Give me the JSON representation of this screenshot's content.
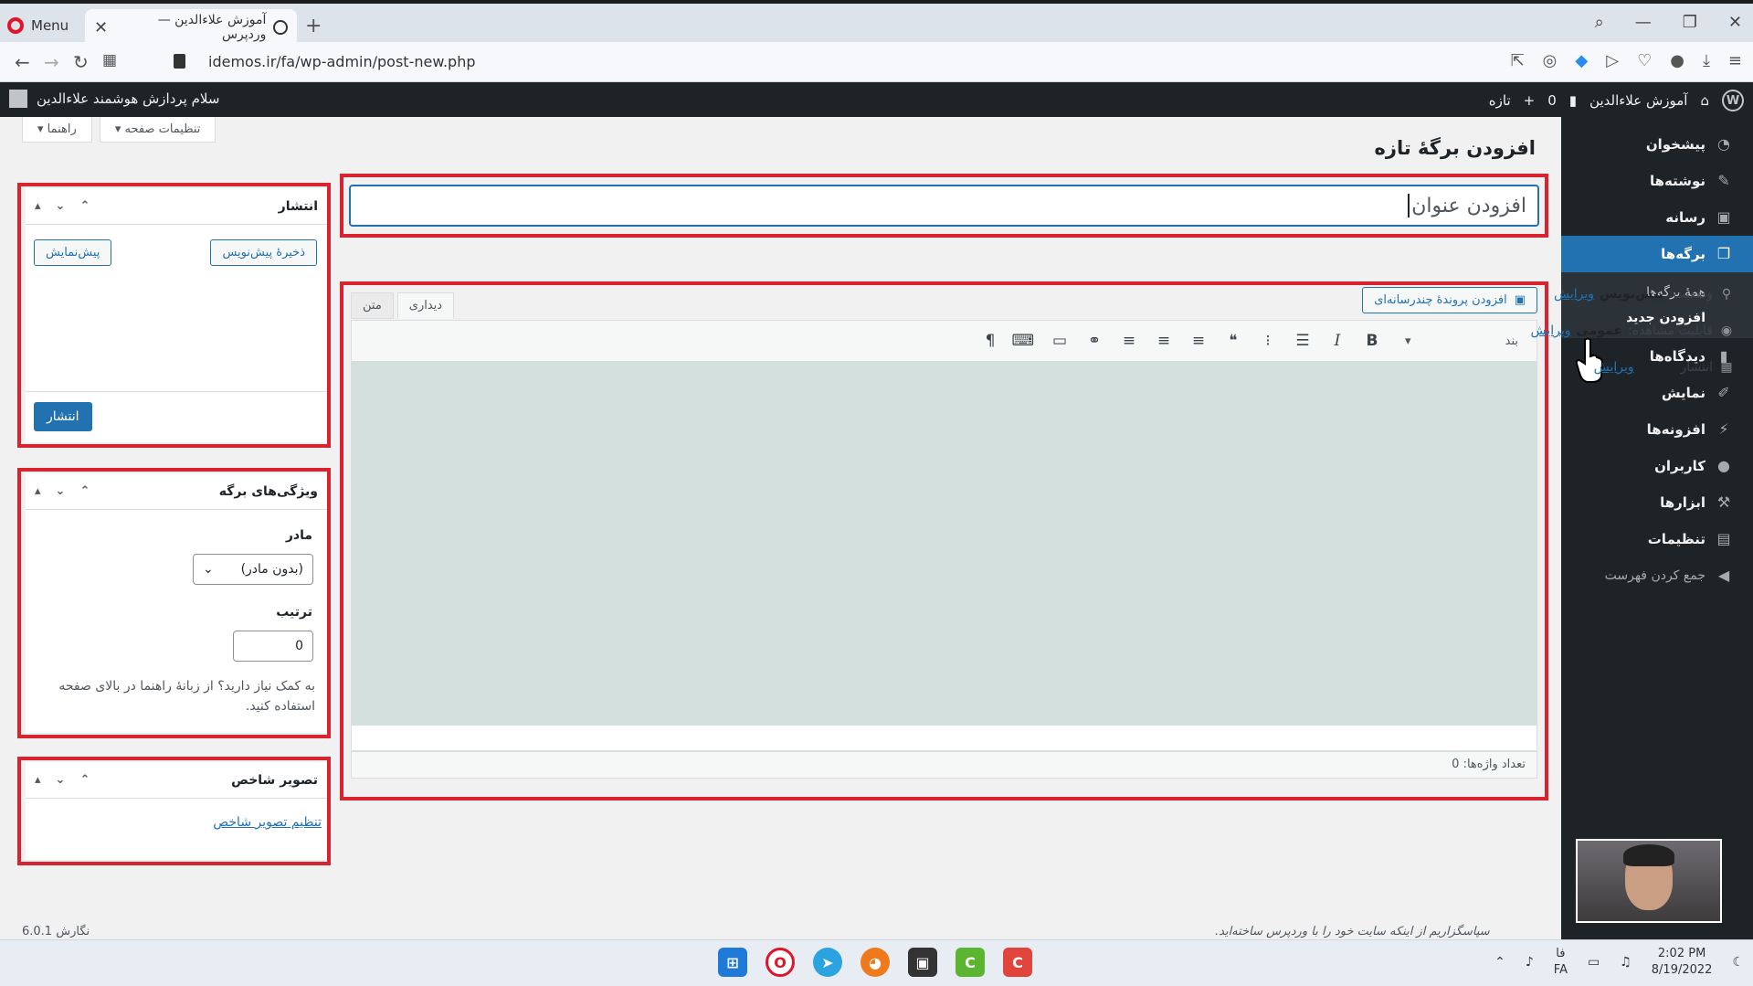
{
  "browser": {
    "menu_label": "Menu",
    "tab_title": "آموزش علاءالدین — وردپرس",
    "tab_close": "✕",
    "new_tab": "+",
    "url": "idemos.ir/fa/wp-admin/post-new.php"
  },
  "adminbar": {
    "site_name": "آموزش علاءالدین",
    "comments_count": "0",
    "new_label": "تازه",
    "greeting": "سلام پردازش هوشمند علاءالدین"
  },
  "sidebar": {
    "items": [
      {
        "label": "پیشخوان",
        "icon": "dashboard-icon"
      },
      {
        "label": "نوشته‌ها",
        "icon": "pin-icon"
      },
      {
        "label": "رسانه",
        "icon": "media-icon"
      },
      {
        "label": "برگه‌ها",
        "icon": "pages-icon"
      }
    ],
    "submenu": [
      "همهٔ برگه‌ها",
      "افزودن جدید"
    ],
    "items2": [
      {
        "label": "دیدگاه‌ها",
        "icon": "comments-icon"
      },
      {
        "label": "نمایش",
        "icon": "appearance-icon"
      },
      {
        "label": "افزونه‌ها",
        "icon": "plugins-icon"
      },
      {
        "label": "کاربران",
        "icon": "users-icon"
      },
      {
        "label": "ابزارها",
        "icon": "tools-icon"
      },
      {
        "label": "تنظیمات",
        "icon": "settings-icon"
      }
    ],
    "collapse": "جمع کردن فهرست"
  },
  "screen_tabs": {
    "options": "تنظیمات صفحه ▾",
    "help": "راهنما ▾"
  },
  "page": {
    "title": "افزودن برگهٔ تازه",
    "title_placeholder": "افزودن عنوان"
  },
  "editor": {
    "add_media": "افزودن پروندهٔ چندرسانه‌ای",
    "tab_visual": "دیداری",
    "tab_text": "متن",
    "format": "بند",
    "word_count": "تعداد واژه‌ها: 0"
  },
  "publish": {
    "title": "انتشار",
    "save_draft": "ذخیرهٔ پیش‌نویس",
    "preview": "پیش‌نمایش",
    "status_label": "وضعیت:",
    "status_value": "پیش‌نویس",
    "visibility_label": "قابلیت مشاهده:",
    "visibility_value": "عمومی",
    "schedule_label": "انتشار",
    "schedule_value": "فوری",
    "edit": "ویرایش",
    "publish_btn": "انتشار"
  },
  "attributes": {
    "title": "ویژگی‌های برگه",
    "parent_label": "مادر",
    "parent_value": "(بدون مادر)",
    "order_label": "ترتیب",
    "order_value": "0",
    "help": "به کمک نیاز دارید؟ از زبانهٔ راهنما در بالای صفحه استفاده کنید."
  },
  "thumbnail": {
    "title": "تصویر شاخص",
    "set_link": "تنظیم تصویر شاخص"
  },
  "footer": {
    "version": "6.0.1 نگارش",
    "thanks": "سپاسگزاریم از اینکه سایت خود را با وردپرس ساخته‌اید."
  },
  "taskbar": {
    "lang": "فا",
    "lang_code": "FA",
    "time": "2:02 PM",
    "date": "8/19/2022"
  },
  "colors": {
    "accent": "#2271b1",
    "admin_dark": "#1d2327",
    "highlight_red": "#d9232e",
    "editor_bg": "#d3e0de"
  }
}
